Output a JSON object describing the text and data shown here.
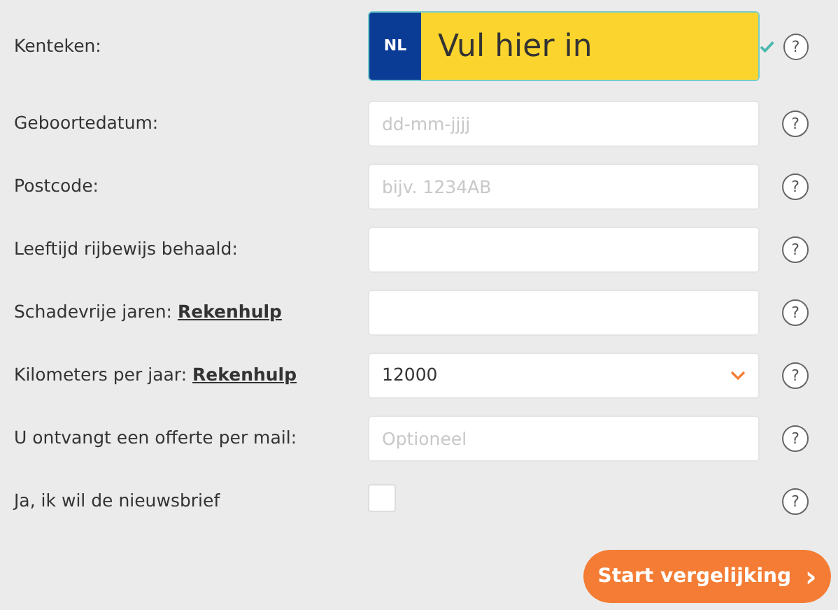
{
  "fields": [
    {
      "kind": "plate",
      "label": "Kenteken:",
      "country": "NL",
      "placeholder": "Vul hier in",
      "valid": true,
      "help": "?"
    },
    {
      "kind": "text",
      "label": "Geboortedatum:",
      "placeholder": "dd-mm-jjjj",
      "help": "?"
    },
    {
      "kind": "text",
      "label": "Postcode:",
      "placeholder": "bijv. 1234AB",
      "help": "?"
    },
    {
      "kind": "text",
      "label": "Leeftijd rijbewijs behaald:",
      "help": "?"
    },
    {
      "kind": "text",
      "label": "Schadevrije jaren:",
      "link": "Rekenhulp",
      "help": "?"
    },
    {
      "kind": "select",
      "label": "Kilometers per jaar:",
      "link": "Rekenhulp",
      "value": "12000",
      "help": "?"
    },
    {
      "kind": "text",
      "label": "U ontvangt een offerte per mail:",
      "placeholder": "Optioneel",
      "help": "?"
    },
    {
      "kind": "checkbox",
      "label": "Ja, ik wil de nieuwsbrief",
      "checked": false,
      "help": "?"
    }
  ],
  "submit": {
    "label": "Start vergelijking",
    "arrow": "›"
  }
}
